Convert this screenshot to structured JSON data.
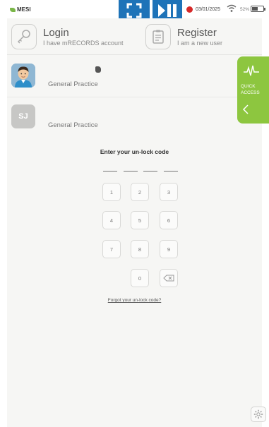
{
  "status_bar": {
    "brand": "MESI",
    "date": "03/01/2025",
    "battery": "52%",
    "battery_level": 0.52,
    "recording": true
  },
  "actions": {
    "login": {
      "title": "Login",
      "subtitle": "I have mRECORDS account",
      "icon": "key-icon"
    },
    "register": {
      "title": "Register",
      "subtitle": "I am a new user",
      "icon": "clipboard-icon"
    }
  },
  "users": [
    {
      "name": "",
      "practice": "General Practice",
      "avatar": "photo"
    },
    {
      "name": "",
      "practice": "General Practice",
      "initials": "SJ"
    }
  ],
  "unlock": {
    "title": "Enter your un-lock code",
    "slots": 4,
    "keys": [
      "1",
      "2",
      "3",
      "4",
      "5",
      "6",
      "7",
      "8",
      "9",
      "0"
    ],
    "forgot_link": "Forgot your un-lock code?"
  },
  "quick_access": {
    "label": "QUICK ACCESS"
  },
  "colors": {
    "accent_green": "#8dc63f",
    "recorder_blue": "#1e73b8",
    "record_red": "#d62828"
  }
}
